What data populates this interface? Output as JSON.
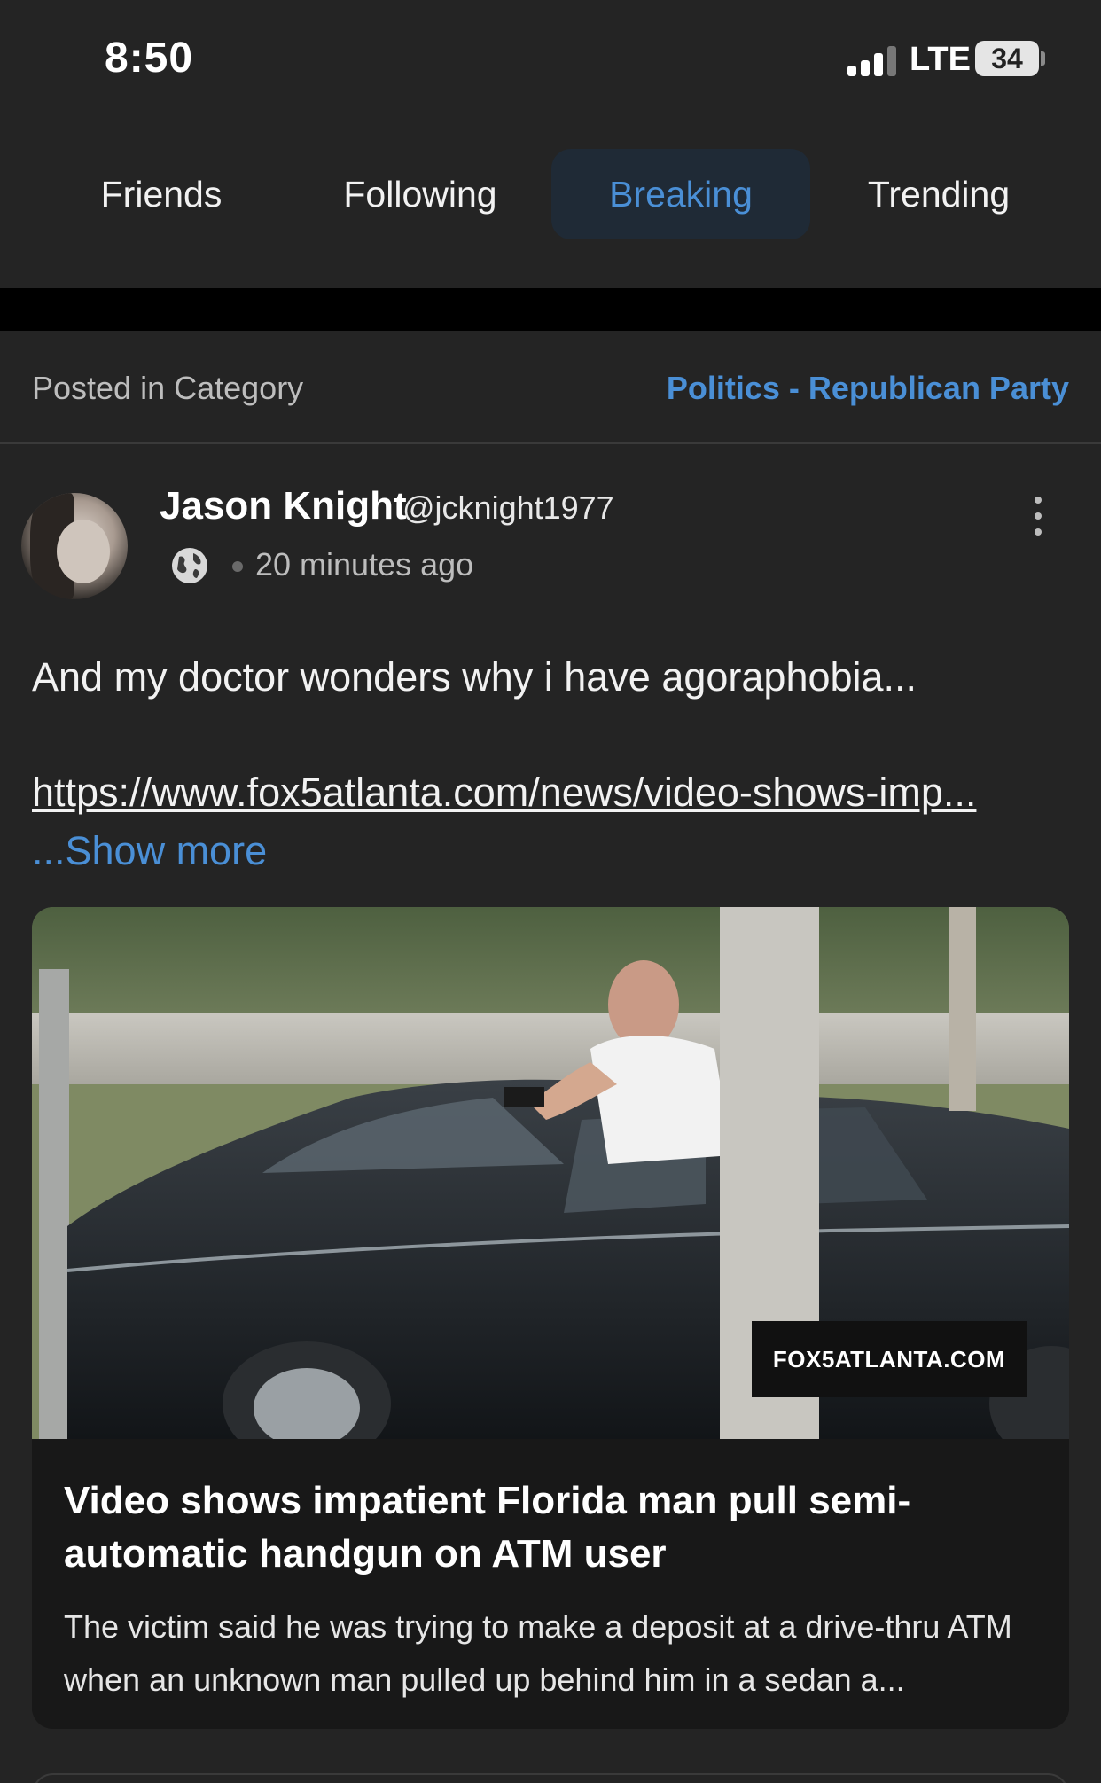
{
  "status_bar": {
    "time": "8:50",
    "network": "LTE",
    "battery": "34"
  },
  "tabs": [
    {
      "label": "Friends",
      "active": false
    },
    {
      "label": "Following",
      "active": false
    },
    {
      "label": "Breaking",
      "active": true
    },
    {
      "label": "Trending",
      "active": false
    }
  ],
  "category": {
    "label": "Posted in Category",
    "value": "Politics - Republican Party"
  },
  "post": {
    "author_name": "Jason Knight",
    "author_handle": "@jcknight1977",
    "visibility_icon": "globe-icon",
    "time_ago": "20 minutes ago",
    "text": "And my doctor wonders why i have agoraphobia...",
    "link": "https://www.fox5atlanta.com/news/video-shows-imp...",
    "show_more": "...Show more"
  },
  "link_card": {
    "source": "FOX5ATLANTA.COM",
    "title": "Video shows impatient Florida man pull semi-automatic handgun on ATM user",
    "description": "The victim said he was trying to make a deposit at a drive-thru ATM when an unknown man pulled up behind him in a sedan a..."
  },
  "colors": {
    "background": "#242424",
    "accent": "#4a8fd6",
    "active_tab_bg": "#1f2a36"
  }
}
